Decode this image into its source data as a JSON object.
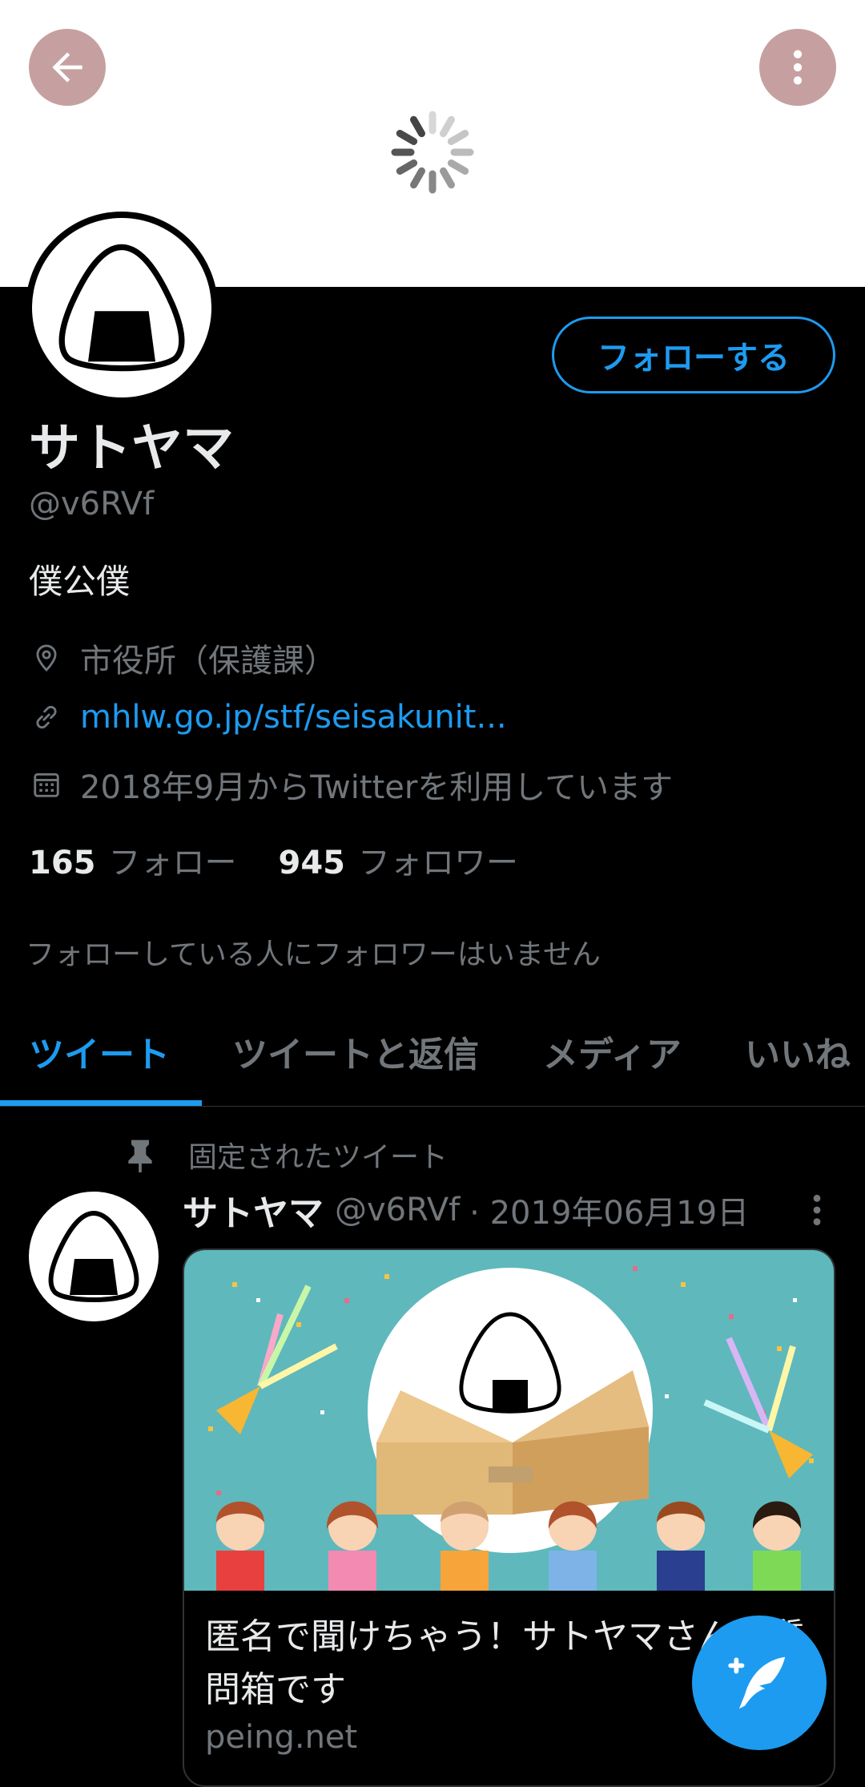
{
  "profile": {
    "name": "サトヤマ",
    "handle": "@v6RVf",
    "bio": "僕公僕",
    "location": "市役所（保護課）",
    "website": "mhlw.go.jp/stf/seisakunit...",
    "joined": "2018年9月からTwitterを利用しています",
    "follow_button": "フォローする",
    "following_count": "165",
    "following_label": "フォロー",
    "followers_count": "945",
    "followers_label": "フォロワー",
    "followers_you_know": "フォローしている人にフォロワーはいません"
  },
  "tabs": [
    {
      "label": "ツイート",
      "active": true
    },
    {
      "label": "ツイートと返信",
      "active": false
    },
    {
      "label": "メディア",
      "active": false
    },
    {
      "label": "いいね",
      "active": false
    }
  ],
  "pinned_tweet": {
    "pinned_label": "固定されたツイート",
    "author_name": "サトヤマ",
    "author_handle": "@v6RVf",
    "date": "· 2019年06月19日",
    "card_title": "匿名で聞けちゃう！サトヤマさんの質問箱です",
    "card_domain": "peing.net"
  },
  "icons": {
    "back": "arrow-left-icon",
    "more": "more-vertical-icon",
    "location": "location-pin-icon",
    "link": "link-icon",
    "calendar": "calendar-icon",
    "pin": "pin-icon",
    "compose": "compose-tweet-icon"
  },
  "colors": {
    "accent": "#1d9bf0",
    "background": "#000000",
    "secondary_text": "#71767b",
    "header_button": "#c6a0a0"
  }
}
